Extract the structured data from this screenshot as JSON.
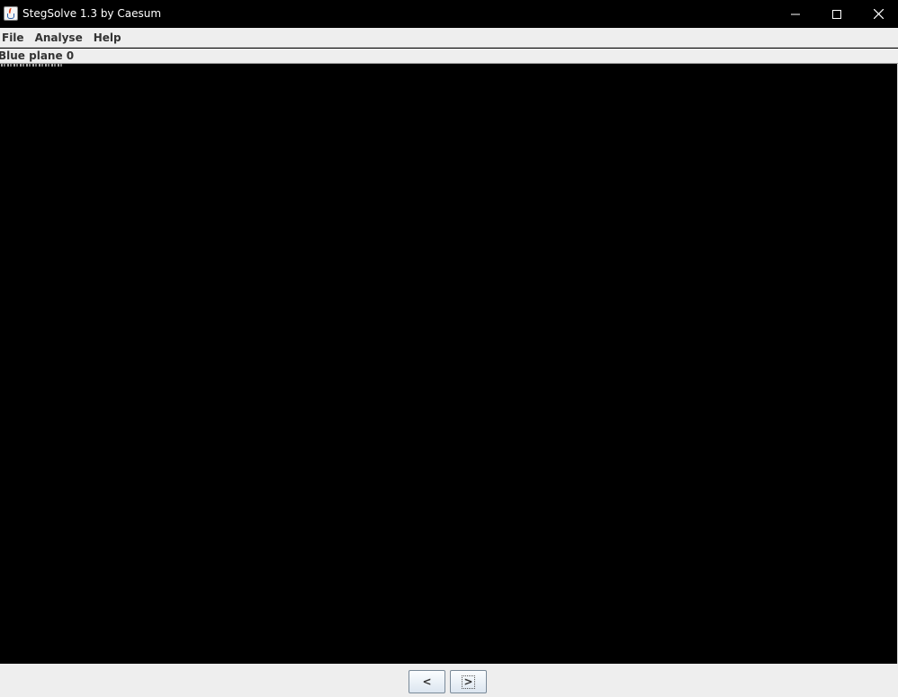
{
  "window": {
    "title": "StegSolve 1.3 by Caesum",
    "icon": "java-cup-icon",
    "controls": {
      "minimize": "minimize-icon",
      "maximize": "maximize-icon",
      "close": "close-icon"
    }
  },
  "menu": {
    "items": [
      {
        "label": "File"
      },
      {
        "label": "Analyse"
      },
      {
        "label": "Help"
      }
    ]
  },
  "status": {
    "plane_label": "Blue plane 0"
  },
  "image_area": {
    "background": "#000000"
  },
  "navigation": {
    "prev_label": "<",
    "next_label": ">"
  },
  "colors": {
    "titlebar_bg": "#000000",
    "chrome_bg": "#eeeeee",
    "text": "#333333"
  }
}
